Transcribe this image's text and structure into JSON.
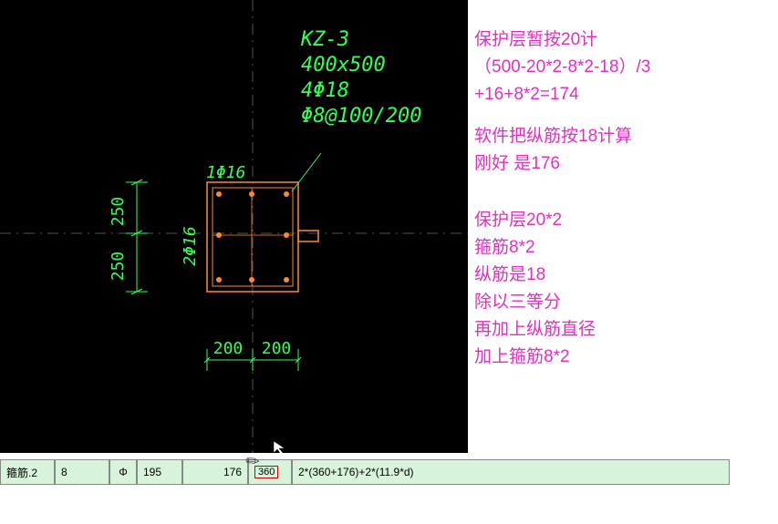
{
  "cad": {
    "labels": {
      "kz": "KZ-3",
      "dims": "400x500",
      "bars": "4Φ18",
      "stirrup": "Φ8@100/200",
      "top_bar": "1Φ16",
      "side_bar": "2Φ16",
      "dim_v1": "250",
      "dim_v2": "250",
      "dim_h1": "200",
      "dim_h2": "200"
    },
    "colors": {
      "green": "#33ff55",
      "orange": "#ff8833",
      "white": "#ffffff",
      "gray": "#555555"
    }
  },
  "annotations": {
    "block1": [
      "保护层暂按20计",
      "（500-20*2-8*2-18）/3",
      "+16+8*2=174"
    ],
    "block2": [
      "软件把纵筋按18计算",
      "刚好 是176"
    ],
    "block3": [
      "保护层20*2",
      "箍筋8*2",
      "纵筋是18",
      "除以三等分",
      "再加上纵筋直径",
      "加上箍筋8*2"
    ]
  },
  "table": {
    "row": {
      "name": "箍筋.2",
      "diam": "8",
      "level_sym": "Φ",
      "num": "195",
      "len": "176",
      "box": "360",
      "formula": "2*(360+176)+2*(11.9*d)"
    }
  }
}
